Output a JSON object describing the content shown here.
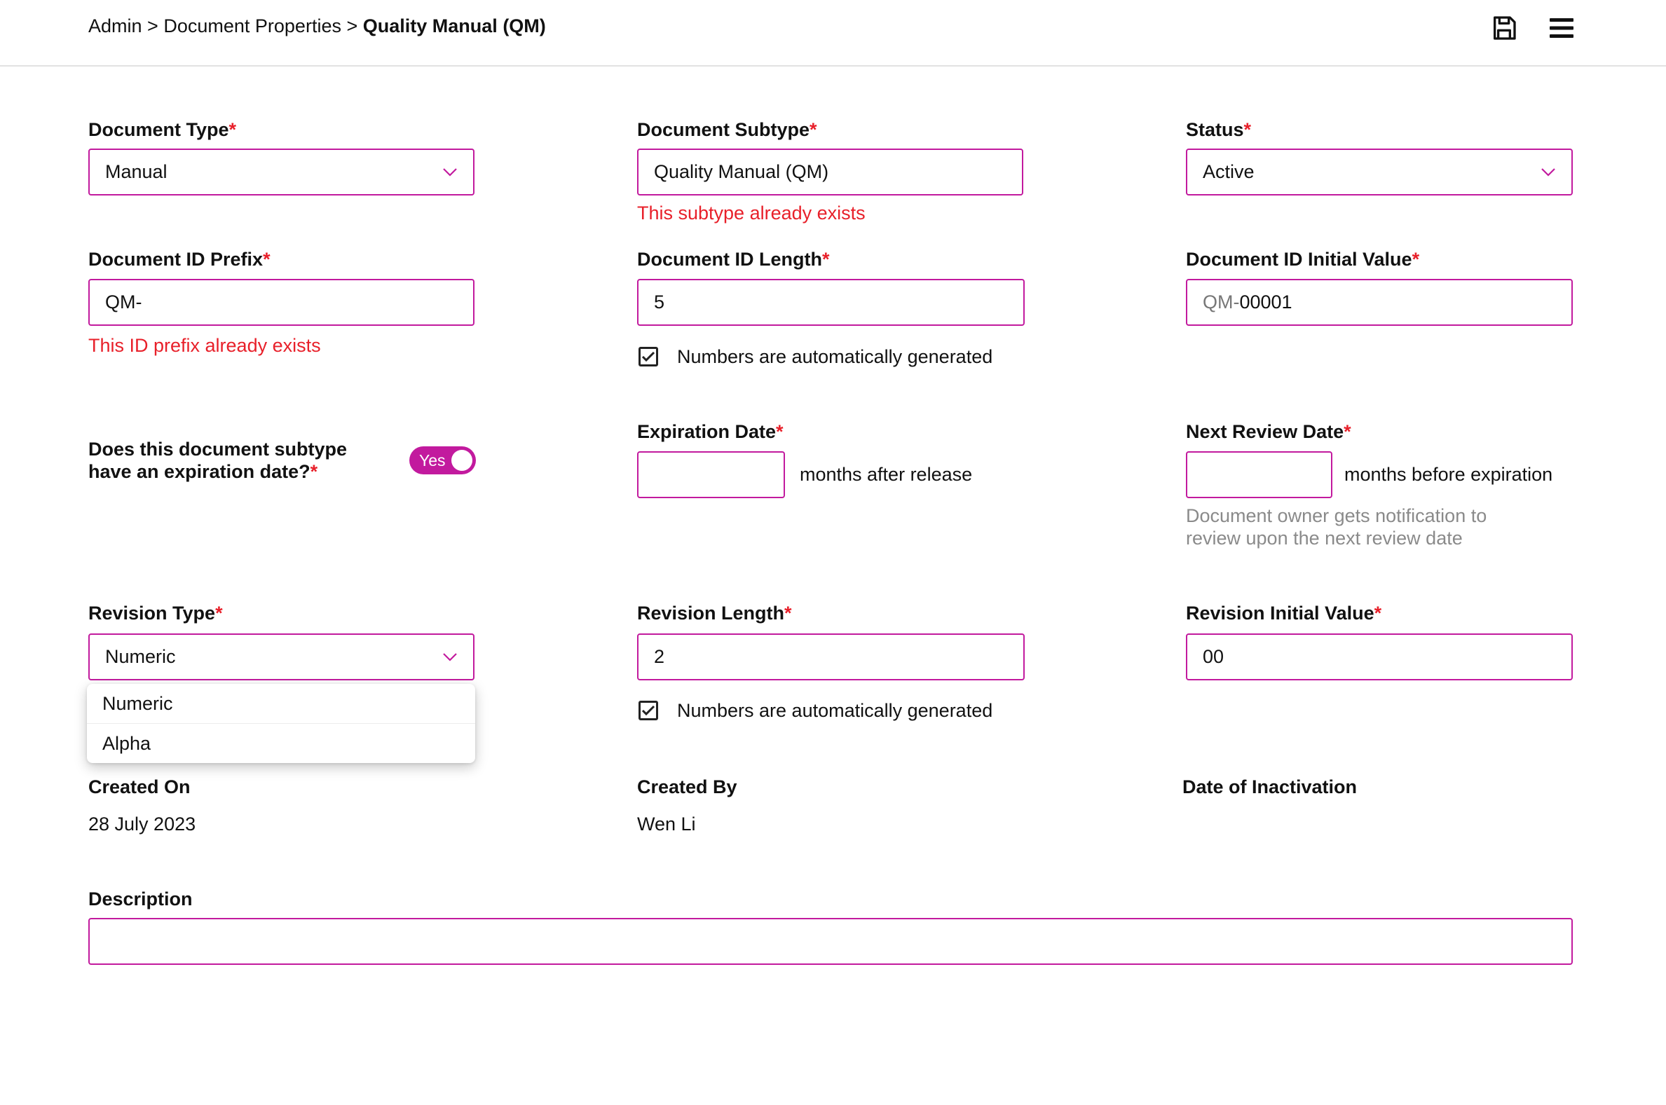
{
  "breadcrumb": {
    "admin": "Admin",
    "sep1": ">",
    "document_properties": "Document Properties",
    "sep2": ">",
    "current": "Quality Manual (QM)"
  },
  "toolbar": {
    "save_icon": "save-icon",
    "menu_icon": "hamburger-menu-icon"
  },
  "colors": {
    "accent": "#c21a9e",
    "error": "#e8202a",
    "hint": "#8a8a8a"
  },
  "required_mark": "*",
  "document_type": {
    "label": "Document Type",
    "value": "Manual"
  },
  "document_subtype": {
    "label": "Document Subtype",
    "value": "Quality Manual (QM)",
    "error": "This subtype already exists"
  },
  "status": {
    "label": "Status",
    "value": "Active"
  },
  "id_prefix": {
    "label": "Document ID Prefix",
    "value": "QM-",
    "error": "This ID prefix already exists"
  },
  "id_length": {
    "label": "Document ID Length",
    "value": "5",
    "checkbox_label": "Numbers are automatically generated",
    "checked": true
  },
  "id_initial": {
    "label": "Document ID Initial Value",
    "prefix": "QM-",
    "value": "00001"
  },
  "expiration_question": {
    "line1": "Does this document subtype",
    "line2": "have an expiration date?",
    "toggle_label": "Yes",
    "toggle_on": true
  },
  "expiration_date": {
    "label": "Expiration Date",
    "value": "",
    "suffix": "months after release"
  },
  "next_review": {
    "label": "Next Review Date",
    "value": "",
    "suffix": "months before expiration",
    "hint_line1": "Document owner gets notification to",
    "hint_line2": "review upon the next review date"
  },
  "revision_type": {
    "label": "Revision Type",
    "value": "Numeric",
    "options": [
      "Numeric",
      "Alpha"
    ]
  },
  "revision_length": {
    "label": "Revision Length",
    "value": "2",
    "checkbox_label": "Numbers are automatically generated",
    "checked": true
  },
  "revision_initial": {
    "label": "Revision Initial Value",
    "value": "00"
  },
  "created_on": {
    "label": "Created On",
    "value": "28 July 2023"
  },
  "created_by": {
    "label": "Created By",
    "value": "Wen Li"
  },
  "date_inactivation": {
    "label": "Date of Inactivation",
    "value": ""
  },
  "description": {
    "label": "Description",
    "value": ""
  }
}
